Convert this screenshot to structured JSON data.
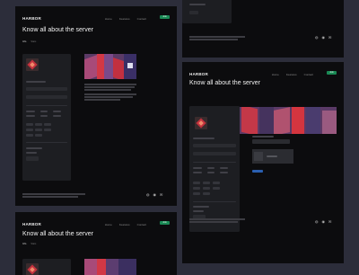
{
  "app": {
    "logo": "HARBOR",
    "nav_links": [
      "Home",
      "Features",
      "Contact"
    ],
    "nav_button": "Join",
    "page_title": "Know all about the server",
    "tabs": [
      "Info",
      "Stats"
    ]
  },
  "footer": {
    "icons": [
      "discord-icon",
      "github-icon",
      "mail-icon"
    ]
  },
  "colors": {
    "background": "#2c2d3a",
    "frame": "#0c0c0e",
    "card": "#1d1e22",
    "accent_green": "#1a8a55",
    "accent_blue": "#2a5fb0",
    "art_red": "#c2313d"
  }
}
